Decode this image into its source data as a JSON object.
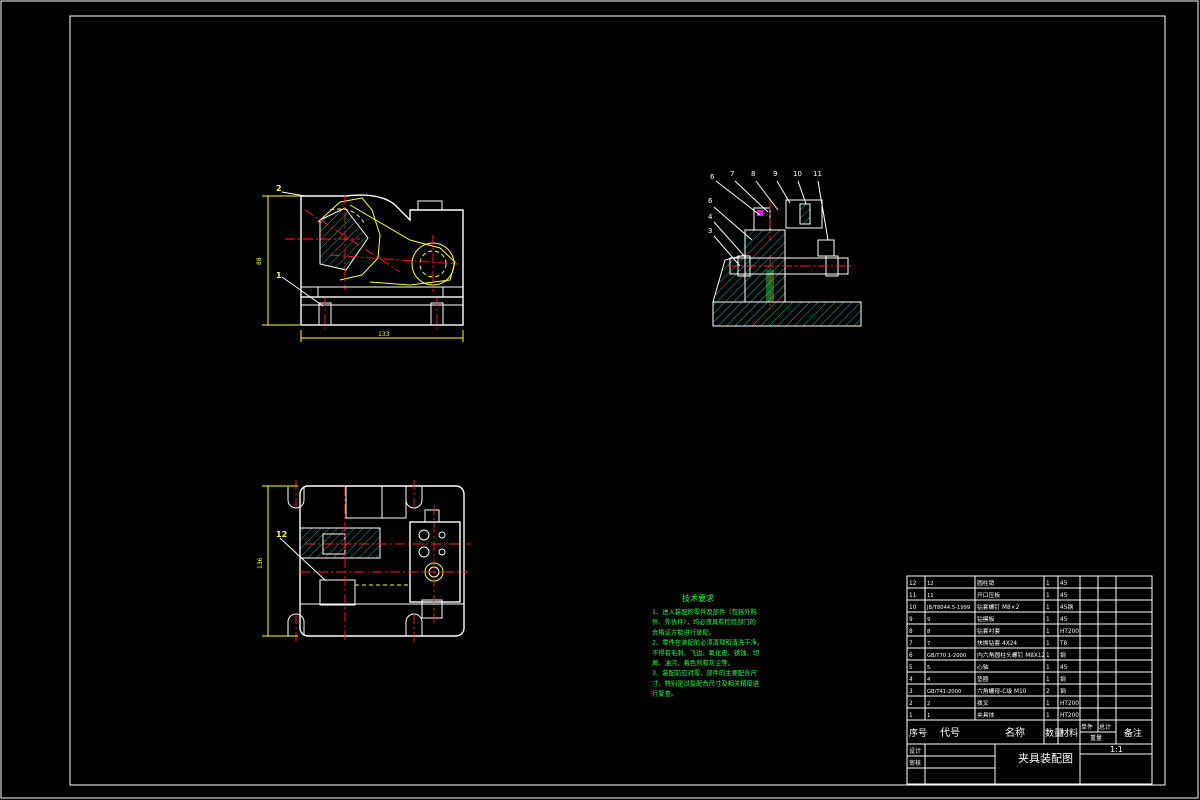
{
  "drawing": {
    "title": "夹具装配图",
    "scale": "1:1",
    "tech_req": {
      "heading": "技术要求",
      "lines": [
        "1、进入装配的零件及部件（包括外购",
        "件、外协件），均必须具有检验部门的",
        "合格证方能进行装配。",
        "2、零件在装配前必须清理和清洗干净，",
        "不得有毛刺、飞边、氧化皮、锈蚀、切",
        "屑、油污、着色剂和灰尘等。",
        "3、装配前应对零、部件的主要配合尺",
        "寸，特别是过盈配合尺寸及相关精度进",
        "行复查。"
      ]
    },
    "dims": {
      "front_width": "133",
      "front_height": "88",
      "top_height": "136"
    },
    "balloons_front": [
      "2",
      "1"
    ],
    "balloons_top": [
      "12"
    ],
    "balloons_section": [
      "6",
      "7",
      "8",
      "9",
      "10",
      "11",
      "6",
      "4",
      "3"
    ]
  },
  "bom": {
    "rows": [
      {
        "no": "12",
        "code": "12",
        "name": "圆柱销",
        "qty": "1",
        "mat": "45"
      },
      {
        "no": "11",
        "code": "11",
        "name": "开口压板",
        "qty": "1",
        "mat": "45"
      },
      {
        "no": "10",
        "code": "JB/T8044.5-1999",
        "name": "钻套螺钉 M8×2",
        "qty": "1",
        "mat": "45钢"
      },
      {
        "no": "9",
        "code": "9",
        "name": "钻模板",
        "qty": "1",
        "mat": "45"
      },
      {
        "no": "8",
        "code": "8",
        "name": "钻套衬套",
        "qty": "1",
        "mat": "HT200"
      },
      {
        "no": "7",
        "code": "7",
        "name": "快换钻套 4X24",
        "qty": "1",
        "mat": "T8"
      },
      {
        "no": "6",
        "code": "GB/T70.1-2000",
        "name": "内六角圆柱头螺钉 M8X12",
        "qty": "1",
        "mat": "钢"
      },
      {
        "no": "5",
        "code": "5",
        "name": "心轴",
        "qty": "1",
        "mat": "45"
      },
      {
        "no": "4",
        "code": "4",
        "name": "垫圈",
        "qty": "1",
        "mat": "钢"
      },
      {
        "no": "3",
        "code": "GB/T41-2000",
        "name": "六角螺母-C级 M10",
        "qty": "2",
        "mat": "钢"
      },
      {
        "no": "2",
        "code": "2",
        "name": "拨叉",
        "qty": "1",
        "mat": "HT200"
      },
      {
        "no": "1",
        "code": "1",
        "name": "夹具体",
        "qty": "1",
        "mat": "HT200"
      }
    ],
    "header": {
      "no": "序号",
      "code": "代号",
      "name": "名称",
      "qty": "数量",
      "mat": "材料",
      "single": "单件",
      "total": "总计",
      "weight": "重量",
      "remark": "备注"
    },
    "footer": {
      "design": "设计",
      "check": "审核"
    }
  },
  "colors": {
    "line": "#ffffff",
    "center": "#ff2020",
    "hidden": "#ffff33",
    "text": "#22ff44",
    "hatch": "#1fc0c0"
  }
}
